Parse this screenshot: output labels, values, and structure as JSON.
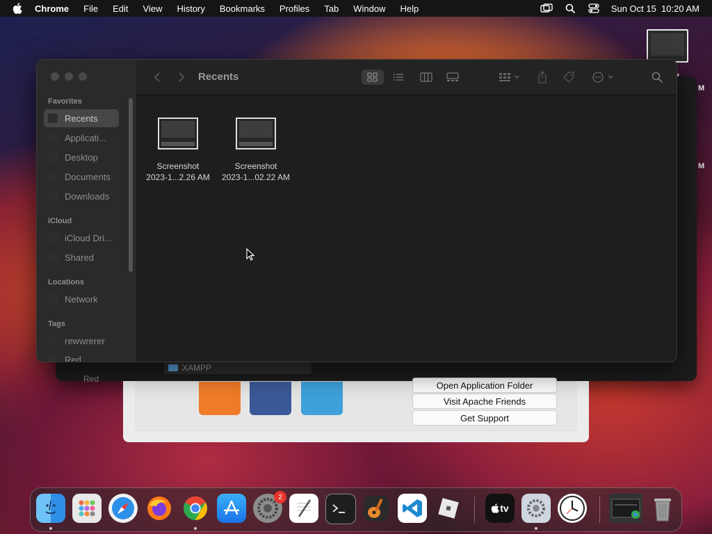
{
  "menubar": {
    "app": "Chrome",
    "items": [
      "File",
      "Edit",
      "View",
      "History",
      "Bookmarks",
      "Profiles",
      "Tab",
      "Window",
      "Help"
    ],
    "datetime": "Sun Oct 15  10:20 AM"
  },
  "desktop": {
    "label_fragment": "hot",
    "time_fragment_1": "M",
    "time_fragment_2": "M"
  },
  "background_finder": {
    "row_label": "XAMPP",
    "tag": "Red"
  },
  "xampp": {
    "buttons": [
      "Open Application Folder",
      "Visit Apache Friends",
      "Get Support"
    ]
  },
  "finder": {
    "title": "Recents",
    "sidebar": {
      "favorites_header": "Favorites",
      "favorites": [
        "Recents",
        "Applicati...",
        "Desktop",
        "Documents",
        "Downloads"
      ],
      "icloud_header": "iCloud",
      "icloud": [
        "iCloud Dri...",
        "Shared"
      ],
      "locations_header": "Locations",
      "locations": [
        "Network"
      ],
      "tags_header": "Tags",
      "tags": [
        "rewwrerer",
        "Red"
      ]
    },
    "files": [
      {
        "name_line1": "Screenshot",
        "name_line2": "2023-1...2.26 AM"
      },
      {
        "name_line1": "Screenshot",
        "name_line2": "2023-1...02.22 AM"
      }
    ]
  },
  "dock": {
    "apps": [
      "finder-icon",
      "launchpad-icon",
      "safari-icon",
      "firefox-icon",
      "chrome-icon",
      "app-store-icon",
      "system-settings-icon",
      "textedit-icon",
      "terminal-icon",
      "garageband-icon",
      "vscode-icon",
      "roblox-icon",
      "apple-tv-icon",
      "system-preferences-icon",
      "clock-icon",
      "chrome-window-icon",
      "trash-icon"
    ],
    "settings_badge": "2",
    "tv_label": "tv"
  }
}
